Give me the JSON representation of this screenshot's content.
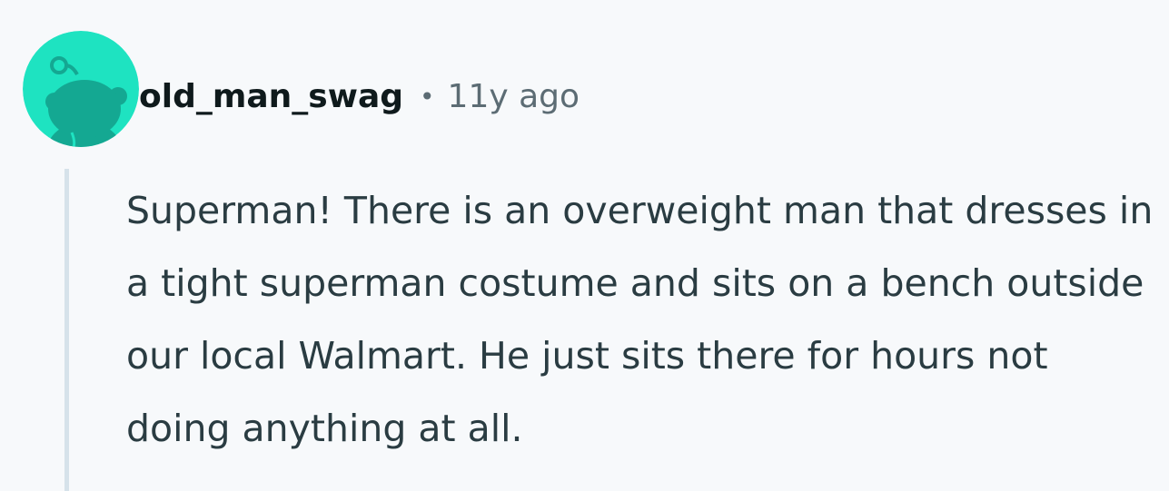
{
  "comment": {
    "author": "old_man_swag",
    "separator": "•",
    "timestamp": "11y ago",
    "body": "Superman! There is an overweight man that dresses in a tight superman costume and sits on a bench outside our local Walmart. He just sits there for hours not doing anything at all.",
    "avatar": {
      "icon": "snoo-avatar-icon",
      "background_color": "#1ee3c1",
      "figure_color": "#14a892"
    }
  },
  "colors": {
    "page_background": "#f7f9fb",
    "author_text": "#0f1a1c",
    "meta_text": "#5c6c74",
    "body_text": "#2a3c42",
    "thread_line": "#d6e2ea"
  }
}
